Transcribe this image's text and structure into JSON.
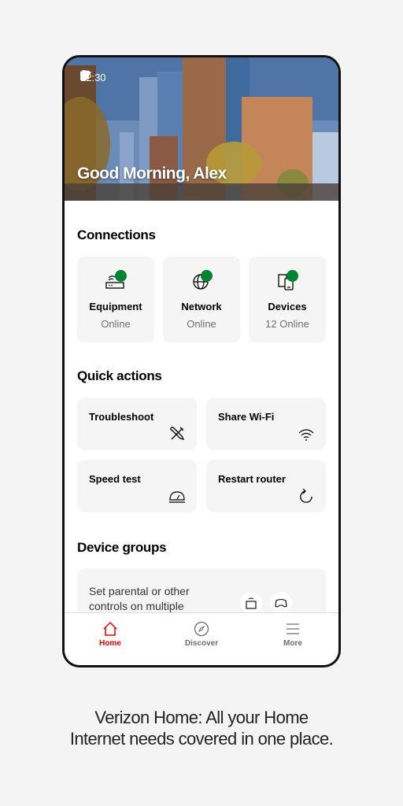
{
  "status_bar": {
    "time": "12:30",
    "icons": [
      "wifi-icon",
      "cell-signal-icon",
      "battery-icon"
    ]
  },
  "hero": {
    "greeting": "Good Morning, Alex",
    "image": "city-skyline"
  },
  "connections": {
    "title": "Connections",
    "items": [
      {
        "name": "Equipment",
        "status": "Online",
        "icon": "router-icon",
        "status_color": "#008331"
      },
      {
        "name": "Network",
        "status": "Online",
        "icon": "globe-icon",
        "status_color": "#008331"
      },
      {
        "name": "Devices",
        "status": "12 Online",
        "icon": "devices-icon",
        "status_color": "#008331"
      }
    ]
  },
  "quick_actions": {
    "title": "Quick actions",
    "items": [
      {
        "label": "Troubleshoot",
        "icon": "tools-icon"
      },
      {
        "label": "Share Wi-Fi",
        "icon": "wifi-icon"
      },
      {
        "label": "Speed test",
        "icon": "speedometer-icon"
      },
      {
        "label": "Restart router",
        "icon": "restart-icon"
      }
    ]
  },
  "device_groups": {
    "title": "Device groups",
    "card_text": "Set parental or other controls on multiple",
    "icons": [
      "tv-icon",
      "gamepad-icon"
    ]
  },
  "bottom_nav": {
    "items": [
      {
        "label": "Home",
        "icon": "home-icon",
        "active": true
      },
      {
        "label": "Discover",
        "icon": "compass-icon",
        "active": false
      },
      {
        "label": "More",
        "icon": "menu-icon",
        "active": false
      }
    ],
    "accent": "#ee0000"
  },
  "caption": {
    "line1": "Verizon Home: All your Home",
    "line2": "Internet needs covered in one place."
  }
}
